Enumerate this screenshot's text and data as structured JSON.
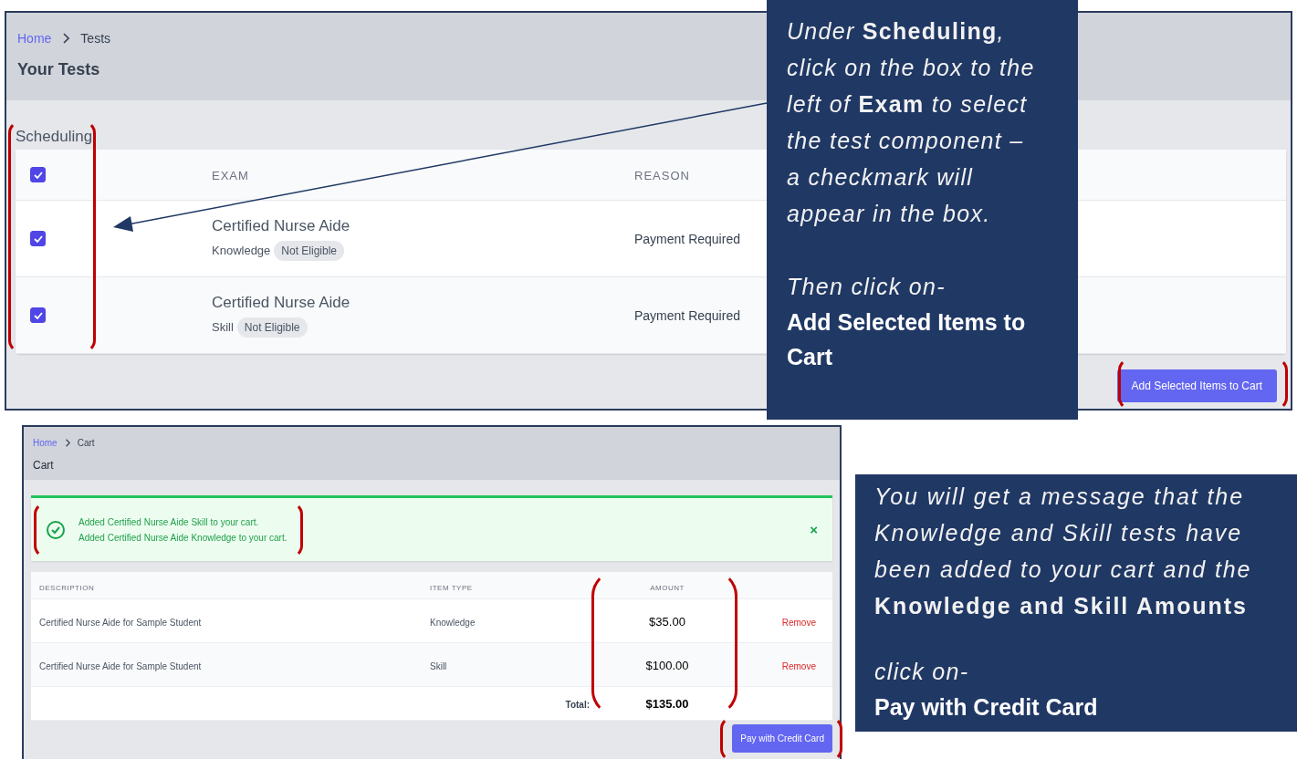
{
  "top_screen": {
    "breadcrumb": [
      "Home",
      "Tests"
    ],
    "title": "Your Tests",
    "section": "Scheduling",
    "select_all": {
      "checked": true
    },
    "columns": [
      "EXAM",
      "REASON"
    ],
    "rows": [
      {
        "checked": true,
        "title": "Certified Nurse Aide",
        "type": "Knowledge",
        "status": "Not Eligible",
        "reason": "Payment Required"
      },
      {
        "checked": true,
        "title": "Certified Nurse Aide",
        "type": "Skill",
        "status": "Not Eligible",
        "reason": "Payment Required"
      }
    ],
    "button": "Add Selected Items to Cart"
  },
  "callouts": [
    {
      "text": "Under **Scheduling**, click on the box to the left of **Exam** to select the test component – a checkmark will appear in the box.",
      "prompt": "Then click on-",
      "action": "Add Selected Items to Cart"
    },
    {
      "text": "You will get a message that the Knowledge and Skill tests have been added to your cart and the **Knowledge and Skill Amounts**",
      "prompt": "click on-",
      "action": "Pay with Credit Card"
    }
  ],
  "cart_screen": {
    "breadcrumb": [
      "Home",
      "Cart"
    ],
    "title": "Cart",
    "alert": {
      "messages": [
        "Added Certified Nurse Aide Skill to your cart.",
        "Added Certified Nurse Aide Knowledge to your cart."
      ],
      "close": "×"
    },
    "columns": [
      "DESCRIPTION",
      "ITEM TYPE",
      "AMOUNT"
    ],
    "rows": [
      {
        "description": "Certified Nurse Aide for Sample Student",
        "item_type": "Knowledge",
        "amount": "$35.00",
        "action": "Remove"
      },
      {
        "description": "Certified Nurse Aide for Sample Student",
        "item_type": "Skill",
        "amount": "$100.00",
        "action": "Remove"
      }
    ],
    "total_label": "Total:",
    "total": "$135.00",
    "button": "Pay with Credit Card"
  }
}
